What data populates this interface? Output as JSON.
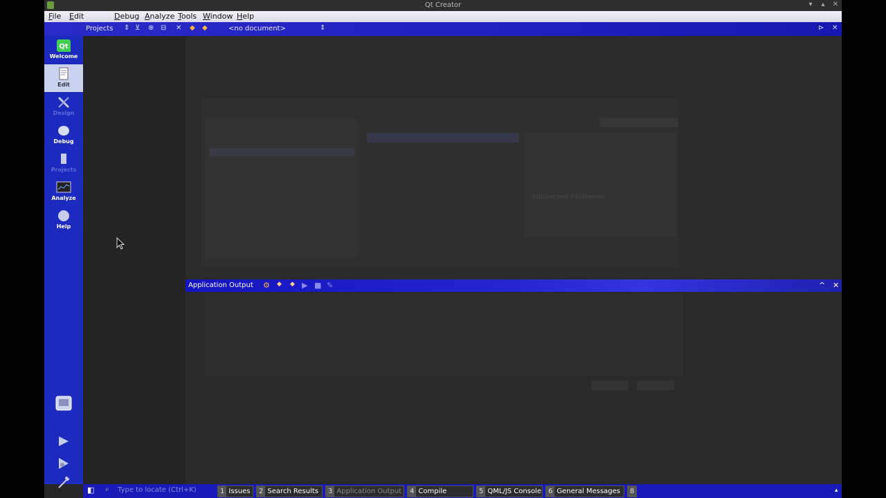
{
  "window": {
    "title": "Qt Creator"
  },
  "menu": [
    "File",
    "Edit",
    "Debug",
    "Analyze",
    "Tools",
    "Window",
    "Help"
  ],
  "toolbar": {
    "projects_label": "Projects",
    "document_selector": "<no document>"
  },
  "modes": [
    {
      "label": "Welcome",
      "state": "normal"
    },
    {
      "label": "Edit",
      "state": "selected"
    },
    {
      "label": "Design",
      "state": "disabled"
    },
    {
      "label": "Debug",
      "state": "normal"
    },
    {
      "label": "Projects",
      "state": "disabled"
    },
    {
      "label": "Analyze",
      "state": "normal"
    },
    {
      "label": "Help",
      "state": "normal"
    }
  ],
  "wizard_ghost": {
    "supported_platforms_label": "Supported Platforms"
  },
  "output_pane": {
    "title": "Application Output"
  },
  "status_bar": {
    "locator_placeholder": "Type to locate (Ctrl+K)",
    "tabs": [
      {
        "num": "1",
        "label": "Issues"
      },
      {
        "num": "2",
        "label": "Search Results"
      },
      {
        "num": "3",
        "label": "Application Output"
      },
      {
        "num": "4",
        "label": "Compile Output"
      },
      {
        "num": "5",
        "label": "QML/JS Console"
      },
      {
        "num": "6",
        "label": "General Messages"
      },
      {
        "num": "8",
        "label": ""
      }
    ]
  },
  "colors": {
    "accent": "#1c2ac0",
    "background": "#262626",
    "menubar": "#e6e6ee"
  }
}
